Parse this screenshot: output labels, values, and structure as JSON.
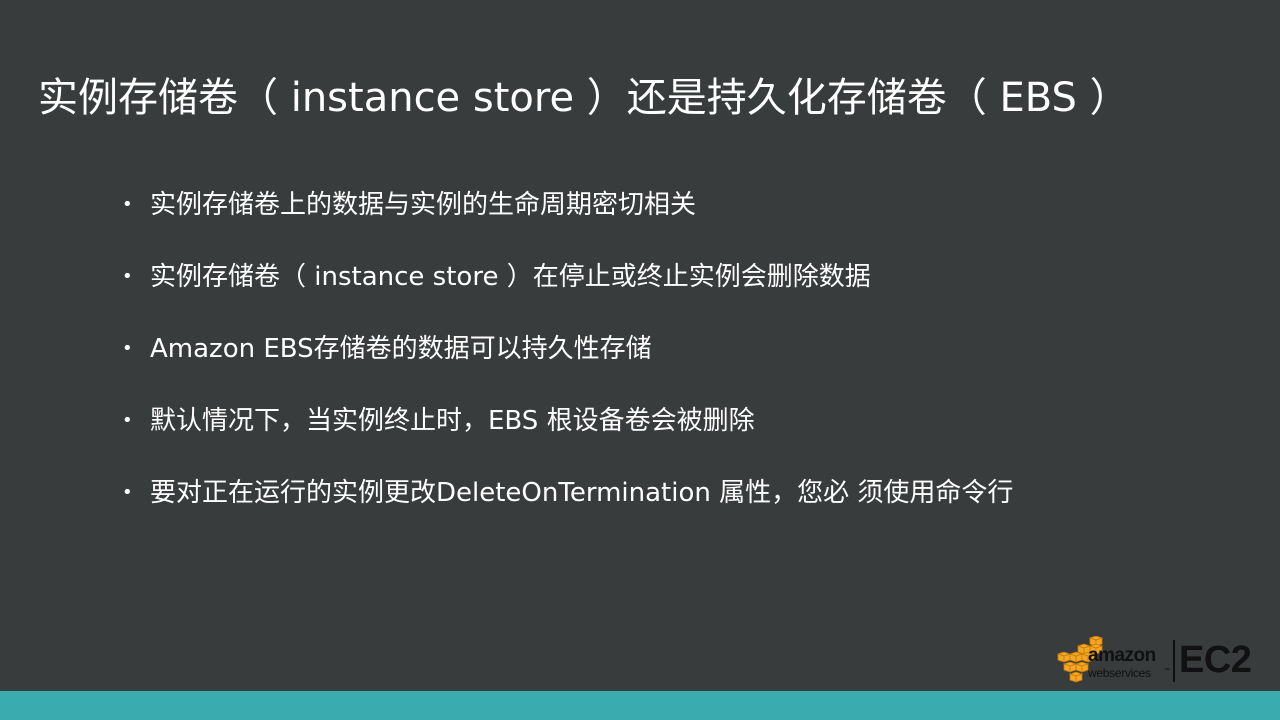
{
  "slide": {
    "title": "实例存储卷（ instance store ）还是持久化存储卷（ EBS ）",
    "bullet_symbol": "•",
    "bullets": [
      "实例存储卷上的数据与实例的生命周期密切相关",
      "实例存储卷（ instance store ）在停止或终止实例会删除数据",
      "Amazon EBS存储卷的数据可以持久性存储",
      "默认情况下，当实例终止时，EBS 根设备卷会被删除",
      "要对正在运行的实例更改DeleteOnTermination 属性，您必 须使用命令行"
    ]
  },
  "logo": {
    "brand": "amazon",
    "subbrand": "webservices",
    "trademark": "™",
    "product": "EC2"
  },
  "colors": {
    "background": "#383c3c",
    "text": "#ffffff",
    "bottom_band": "#3aacb0",
    "logo_cube": "#f5a623",
    "logo_text": "#111111"
  }
}
